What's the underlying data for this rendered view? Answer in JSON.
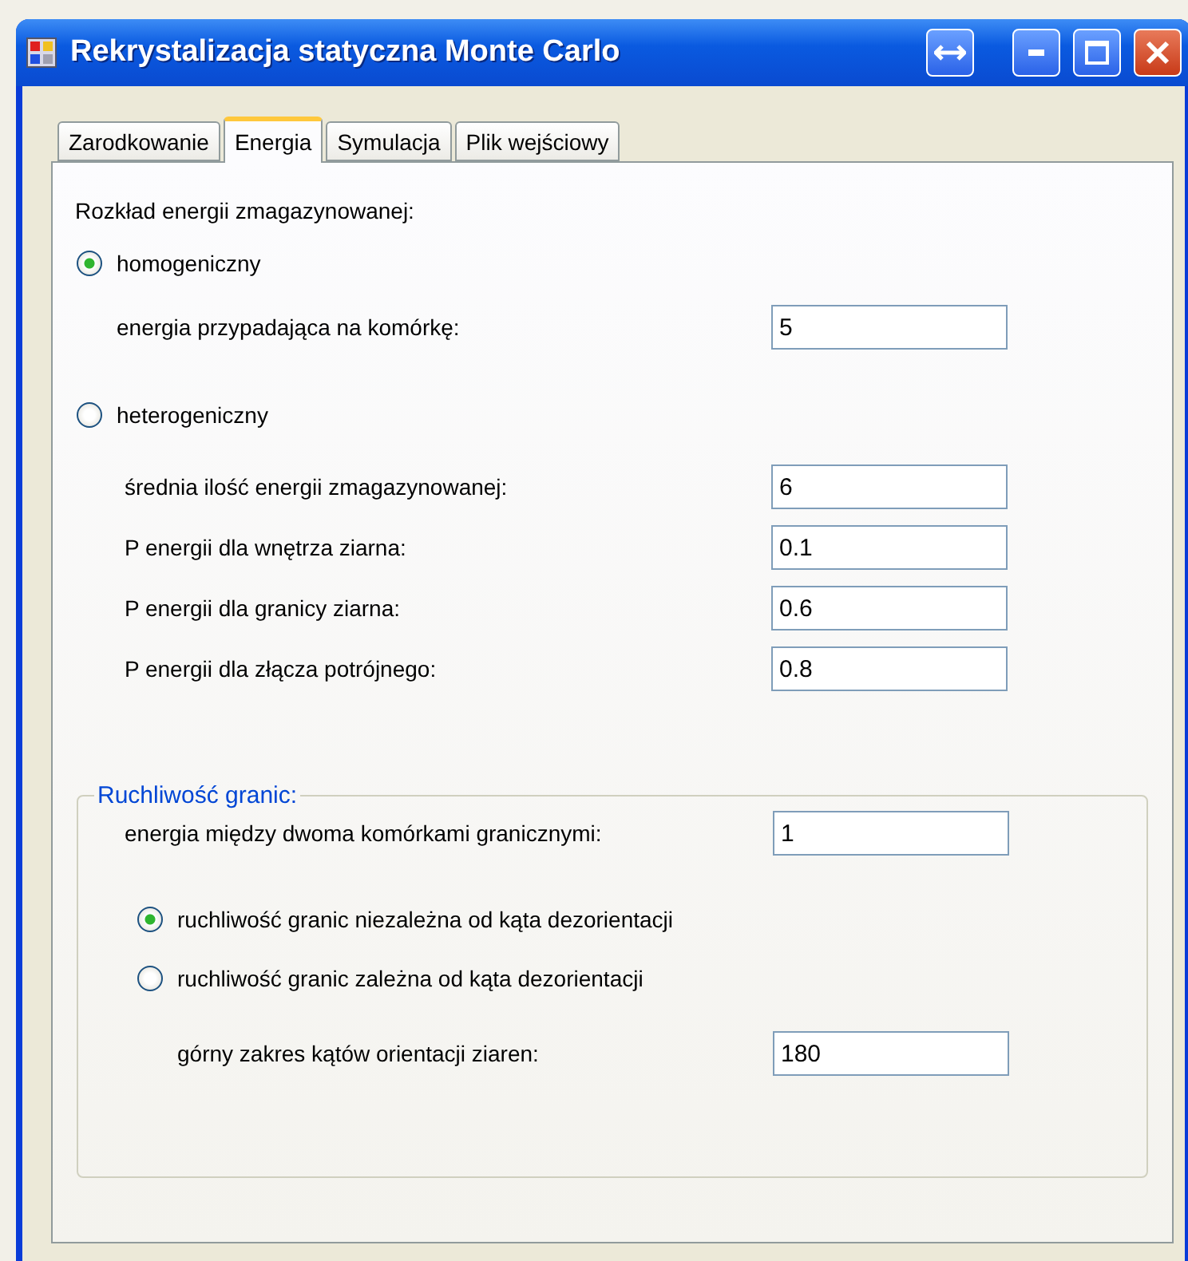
{
  "window": {
    "title": "Rekrystalizacja statyczna Monte Carlo"
  },
  "tabs": [
    {
      "label": "Zarodkowanie",
      "selected": false
    },
    {
      "label": "Energia",
      "selected": true
    },
    {
      "label": "Symulacja",
      "selected": false
    },
    {
      "label": "Plik wejściowy",
      "selected": false
    }
  ],
  "section_label": "Rozkład energii zmagazynowanej:",
  "distribution_options": [
    {
      "label": "homogeniczny",
      "selected": true,
      "fields": [
        {
          "label": "energia przypadająca na komórkę:",
          "value": "5"
        }
      ]
    },
    {
      "label": "heterogeniczny",
      "selected": false,
      "fields": [
        {
          "label": "średnia ilość energii zmagazynowanej:",
          "value": "6"
        },
        {
          "label": "P energii dla wnętrza ziarna:",
          "value": "0.1"
        },
        {
          "label": "P energii dla granicy ziarna:",
          "value": "0.6"
        },
        {
          "label": "P energii dla złącza potrójnego:",
          "value": "0.8"
        }
      ]
    }
  ],
  "mobility_group": {
    "title": "Ruchliwość granic:",
    "fields": [
      {
        "label": "energia między dwoma komórkami granicznymi:",
        "value": "1"
      }
    ],
    "options": [
      {
        "label": "ruchliwość granic niezależna od kąta dezorientacji",
        "selected": true
      },
      {
        "label": "ruchliwość granic zależna od kąta dezorientacji",
        "selected": false
      }
    ],
    "extra_fields": [
      {
        "label": "górny zakres kątów orientacji ziaren:",
        "value": "180"
      }
    ]
  }
}
